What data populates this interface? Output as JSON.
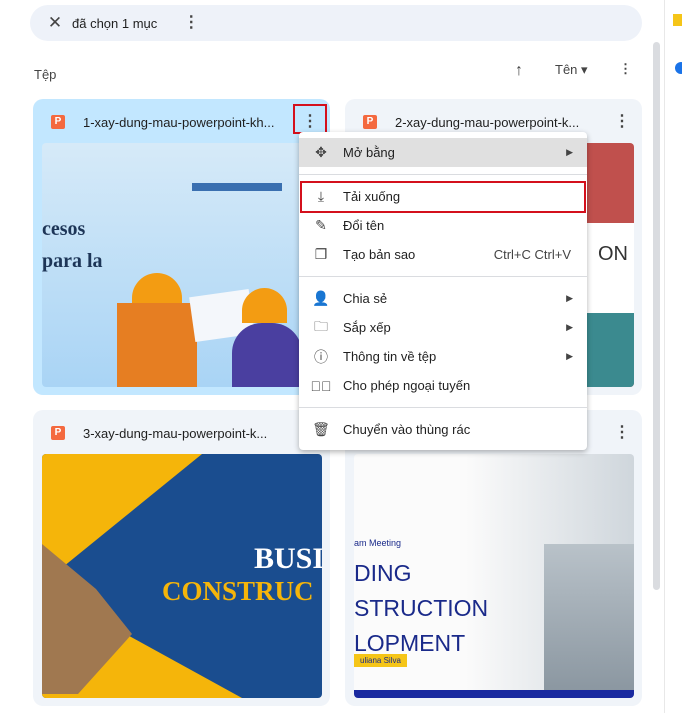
{
  "toolbar": {
    "selected_text": "đã chọn 1 mục"
  },
  "section": {
    "label": "Tệp",
    "sort_label": "Tên"
  },
  "files": [
    {
      "name": "1-xay-dung-mau-powerpoint-kh...",
      "slide_text": [
        "cesos",
        "para la"
      ]
    },
    {
      "name": "2-xay-dung-mau-powerpoint-k...",
      "slide_text": [
        "ON"
      ]
    },
    {
      "name": "3-xay-dung-mau-powerpoint-k...",
      "slide_text": [
        "BUSI",
        "CONSTRUC"
      ]
    },
    {
      "name": "",
      "slide_text": [
        "am Meeting",
        "DING",
        "STRUCTION",
        "LOPMENT",
        "uliana Silva"
      ]
    }
  ],
  "menu": {
    "items": [
      {
        "label": "Mở bằng",
        "icon": "open-with-icon",
        "submenu": true
      },
      {
        "label": "Tải xuống",
        "icon": "download-icon"
      },
      {
        "label": "Đổi tên",
        "icon": "rename-icon"
      },
      {
        "label": "Tạo bản sao",
        "icon": "copy-icon",
        "shortcut": "Ctrl+C Ctrl+V"
      },
      {
        "label": "Chia sẻ",
        "icon": "person-add-icon",
        "submenu": true
      },
      {
        "label": "Sắp xếp",
        "icon": "folder-icon",
        "submenu": true
      },
      {
        "label": "Thông tin về tệp",
        "icon": "info-icon",
        "submenu": true
      },
      {
        "label": "Cho phép ngoại tuyến",
        "icon": "offline-icon"
      },
      {
        "label": "Chuyển vào thùng rác",
        "icon": "trash-icon"
      }
    ]
  },
  "colors": {
    "selected_card": "#c2e7ff",
    "highlight": "#d4101c",
    "ppt": "#f4693f"
  }
}
